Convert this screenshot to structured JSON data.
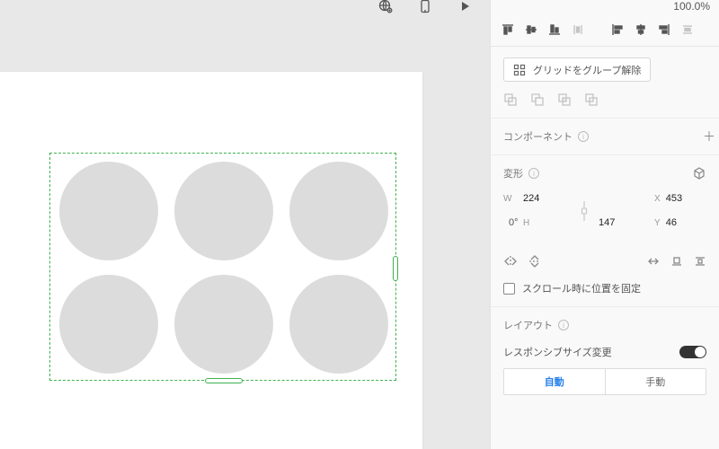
{
  "toolbar": {
    "zoom": "100.0%"
  },
  "panel": {
    "ungroup_label": "グリッドをグループ解除",
    "component_label": "コンポーネント",
    "transform": {
      "label": "変形",
      "w_label": "W",
      "w": "224",
      "x_label": "X",
      "x": "453",
      "h_label": "H",
      "h": "147",
      "y_label": "Y",
      "y": "46",
      "rotation": "0°"
    },
    "fix_scroll_label": "スクロール時に位置を固定",
    "layout_label": "レイアウト",
    "responsive_label": "レスポンシブサイズ変更",
    "seg_auto": "自動",
    "seg_manual": "手動"
  }
}
